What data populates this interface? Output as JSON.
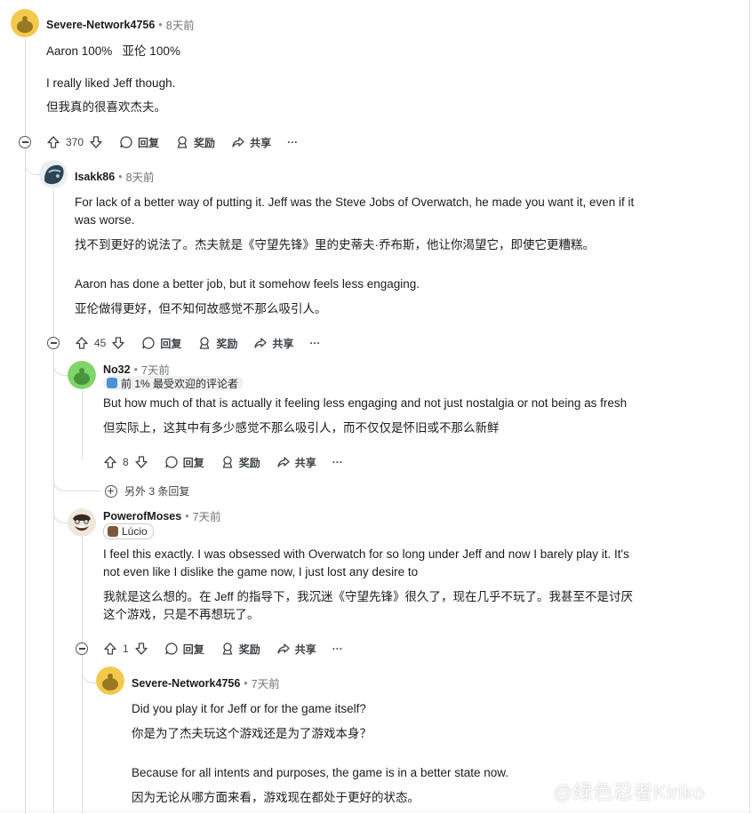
{
  "comments": [
    {
      "user": "Severe-Network4756",
      "time": "8天前",
      "lines": [
        "Aaron 100%   亚伦 100%",
        "",
        "I really liked Jeff though.",
        "但我真的很喜欢杰夫。"
      ],
      "votes": "370"
    },
    {
      "user": "Isakk86",
      "time": "8天前",
      "lines": [
        "For lack of a better way of putting it. Jeff was the Steve Jobs of Overwatch, he made you want it, even if it",
        "was worse.",
        "找不到更好的说法了。杰夫就是《守望先锋》里的史蒂夫·乔布斯，他让你渴望它，即使它更糟糕。",
        "Aaron has done a better job, but it somehow feels less engaging.",
        "亚伦做得更好，但不知何故感觉不那么吸引人。"
      ],
      "votes": "45"
    },
    {
      "user": "No32",
      "time": "7天前",
      "flair": "前 1% 最受欢迎的评论者",
      "lines": [
        "But how much of that is actually it feeling less engaging and not just nostalgia or not being as fresh",
        "但实际上，这其中有多少感觉不那么吸引人，而不仅仅是怀旧或不那么新鲜"
      ],
      "votes": "8",
      "more_replies": "另外 3 条回复"
    },
    {
      "user": "PowerofMoses",
      "time": "7天前",
      "flair": "Lúcio",
      "lines": [
        "I feel this exactly. I was obsessed with Overwatch for so long under Jeff and now I barely play it. It's",
        "not even like I dislike the game now, I just lost any desire to",
        "我就是这么想的。在 Jeff 的指导下，我沉迷《守望先锋》很久了，现在几乎不玩了。我甚至不是讨厌",
        "这个游戏，只是不再想玩了。"
      ],
      "votes": "1"
    },
    {
      "user": "Severe-Network4756",
      "time": "7天前",
      "lines": [
        "Did you play it for Jeff or for the game itself?",
        "你是为了杰夫玩这个游戏还是为了游戏本身？",
        "Because for all intents and purposes, the game is in a better state now.",
        "因为无论从哪方面来看，游戏现在都处于更好的状态。"
      ]
    }
  ],
  "actions": {
    "reply": "回复",
    "award": "奖励",
    "share": "共享",
    "more": "···",
    "sep": "•"
  },
  "watermark": "@绿色忍者Kiriko",
  "colors": {
    "line": "#dcdde0",
    "flair_bg": "#eef0f2",
    "snoo_yellow": "#f2c94c",
    "snoo_green": "#7fd46a"
  }
}
